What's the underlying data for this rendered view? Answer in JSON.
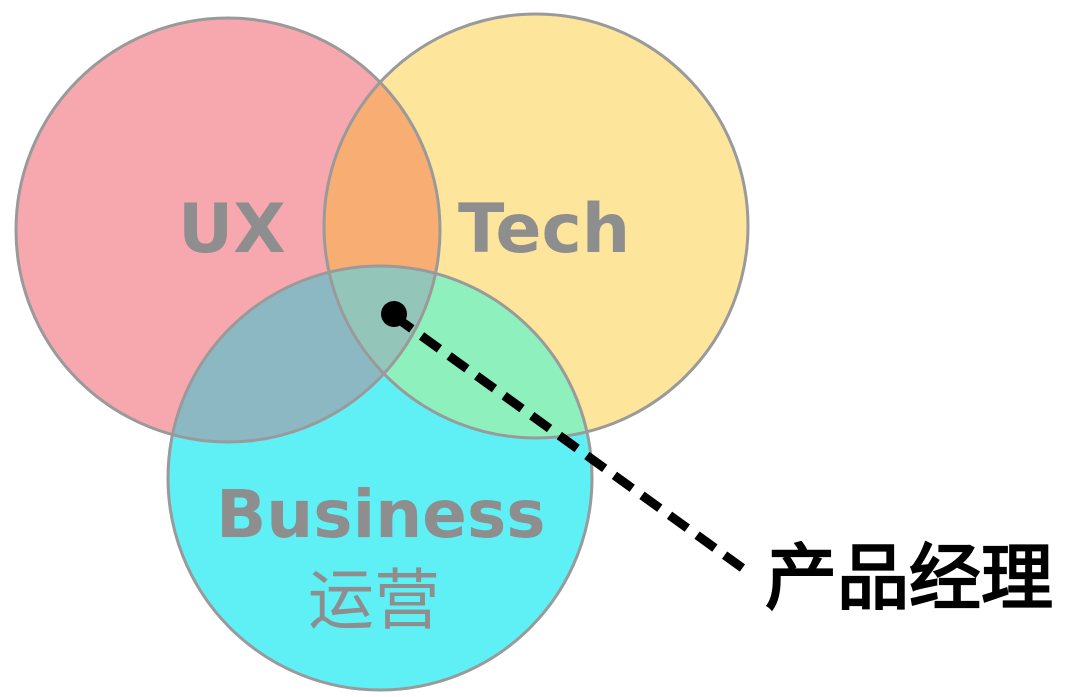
{
  "diagram": {
    "circles": [
      {
        "id": "ux",
        "label": "UX",
        "fill": "#f7a8ae"
      },
      {
        "id": "tech",
        "label": "Tech",
        "fill": "#fde59c"
      },
      {
        "id": "business",
        "label": "Business",
        "sublabel": "运营",
        "fill": "#5ef0f5"
      }
    ],
    "overlaps": {
      "ux_tech": "#f8ad72",
      "ux_business": "#8cb8c4",
      "tech_business": "#8ef0bc",
      "center": "#93c6b8"
    },
    "stroke_color": "#9a9a9a",
    "callout": {
      "text": "产品经理",
      "line_style": "dashed",
      "color": "#000000"
    }
  }
}
